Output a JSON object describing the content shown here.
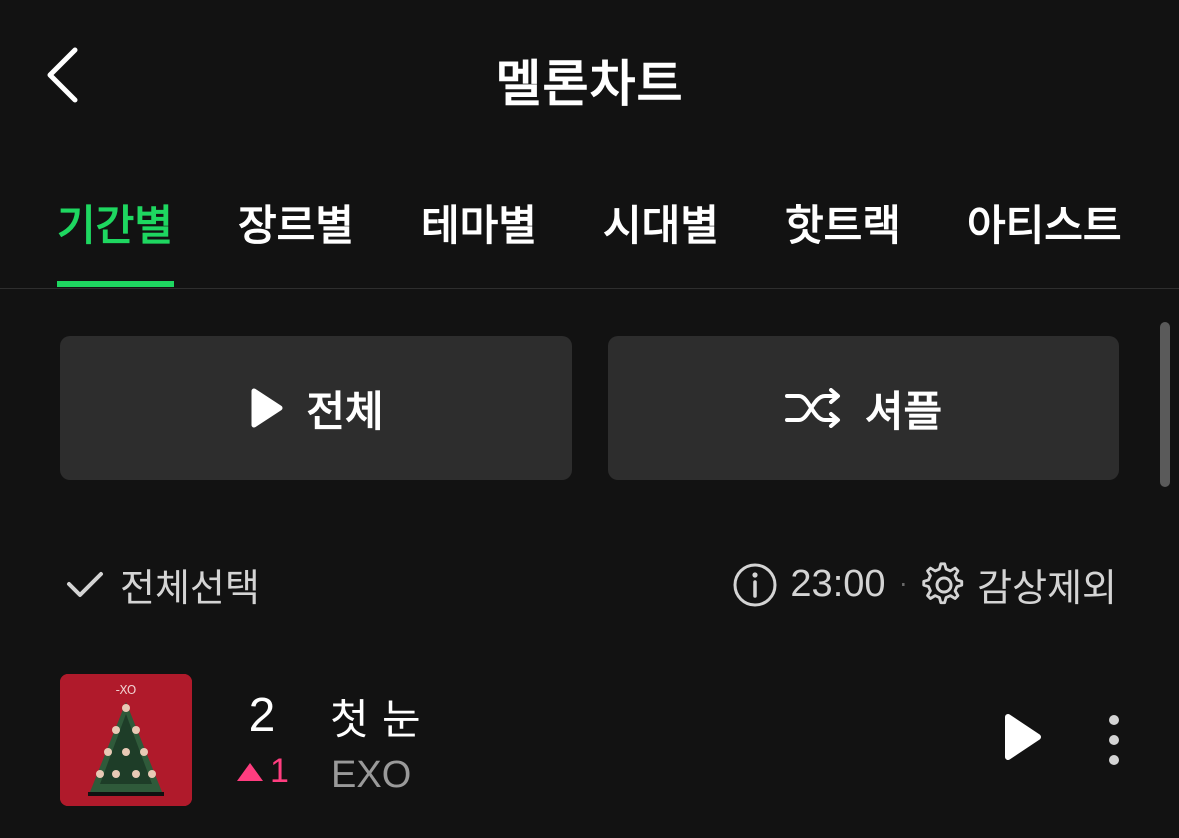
{
  "header": {
    "title": "멜론차트",
    "back_icon": "chevron-left-icon"
  },
  "tabs": [
    {
      "label": "기간별",
      "active": true
    },
    {
      "label": "장르별",
      "active": false
    },
    {
      "label": "테마별",
      "active": false
    },
    {
      "label": "시대별",
      "active": false
    },
    {
      "label": "핫트랙",
      "active": false
    },
    {
      "label": "아티스트",
      "active": false
    }
  ],
  "actions": {
    "play_all_label": "전체",
    "play_all_icon": "play-icon",
    "shuffle_label": "셔플",
    "shuffle_icon": "shuffle-icon"
  },
  "toolbar": {
    "select_all_label": "전체선택",
    "select_all_icon": "checkmark-icon",
    "info_icon": "info-icon",
    "update_time": "23:00",
    "separator": "·",
    "settings_icon": "gear-icon",
    "exclude_label": "감상제외"
  },
  "songs": [
    {
      "rank": "2",
      "rank_change": "1",
      "rank_direction": "up",
      "title": "첫 눈",
      "artist": "EXO",
      "play_icon": "play-icon",
      "more_icon": "more-vertical-icon"
    }
  ],
  "colors": {
    "background": "#121212",
    "accent": "#1ed760",
    "button_bg": "#2d2d2d",
    "rank_up": "#ff3d7f",
    "secondary_text": "#9a9a9a",
    "album_bg": "#b01a2b"
  }
}
